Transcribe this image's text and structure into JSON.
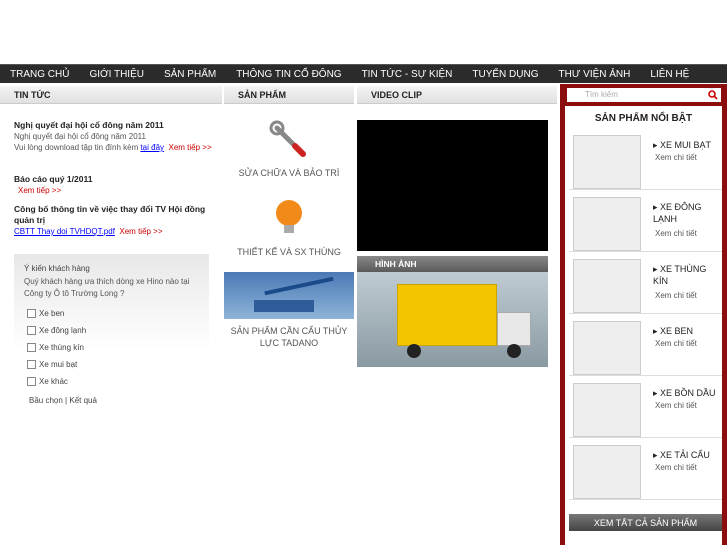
{
  "nav": [
    "TRANG CHỦ",
    "GIỚI THIỆU",
    "SẢN PHẨM",
    "THÔNG TIN CỔ ĐÔNG",
    "TIN TỨC - SỰ KIỆN",
    "TUYỂN DỤNG",
    "THƯ VIỆN ẢNH",
    "LIÊN HỆ"
  ],
  "headers": {
    "news": "TIN TỨC",
    "products": "SẢN PHẨM",
    "video": "VIDEO CLIP"
  },
  "news": [
    {
      "title": "Nghị quyết đại hội cổ đông năm 2011",
      "summary": "Nghị quyết đại hội cổ đông năm 2011",
      "note_prefix": "Vui lòng download tập tin đính kèm ",
      "note_link": "tại đây",
      "more": "Xem tiếp >>"
    },
    {
      "title": "Báo cáo quý 1/2011",
      "more": "Xem tiếp >>"
    },
    {
      "title": "Công bố thông tin về việc thay đổi TV Hội đồng quản trị",
      "attachment": "CBTT Thay doi TVHDQT.pdf",
      "more": "Xem tiếp >>"
    }
  ],
  "poll": {
    "title": "Ý kiến khách hàng",
    "question": "Quý khách hàng ưa thích dòng xe Hino nào tại Công ty Ô tô Trường Long ?",
    "options": [
      "Xe ben",
      "Xe đông lạnh",
      "Xe thùng kín",
      "Xe mui bạt",
      "Xe khác"
    ],
    "vote": "Bầu chọn",
    "sep": "|",
    "results": "Kết quả"
  },
  "services": [
    "SỬA CHỮA VÀ BẢO TRÌ",
    "THIẾT KẾ VÀ SX THÙNG",
    "SẢN PHẨM CẦN CẨU THỦY LỰC TADANO"
  ],
  "images_header": "HÌNH ẢNH",
  "search_placeholder": "Tìm kiếm",
  "featured": {
    "title": "SẢN PHẨM NỔI BẬT",
    "items": [
      {
        "name": "XE MUI BẠT",
        "more": "Xem chi tiết"
      },
      {
        "name": "XE ĐÔNG LẠNH",
        "more": "Xem chi tiết"
      },
      {
        "name": "XE THÙNG KÍN",
        "more": "Xem chi tiết"
      },
      {
        "name": "XE BEN",
        "more": "Xem chi tiết"
      },
      {
        "name": "XE BỒN DẦU",
        "more": "Xem chi tiết"
      },
      {
        "name": "XE TẢI CẨU",
        "more": "Xem chi tiết"
      }
    ],
    "all": "XEM TẤT CẢ SẢN PHẨM"
  },
  "colors": {
    "nav_bg": "#2b2b2b",
    "sidebar": "#8b0d0d",
    "link_red": "#cc0000"
  }
}
